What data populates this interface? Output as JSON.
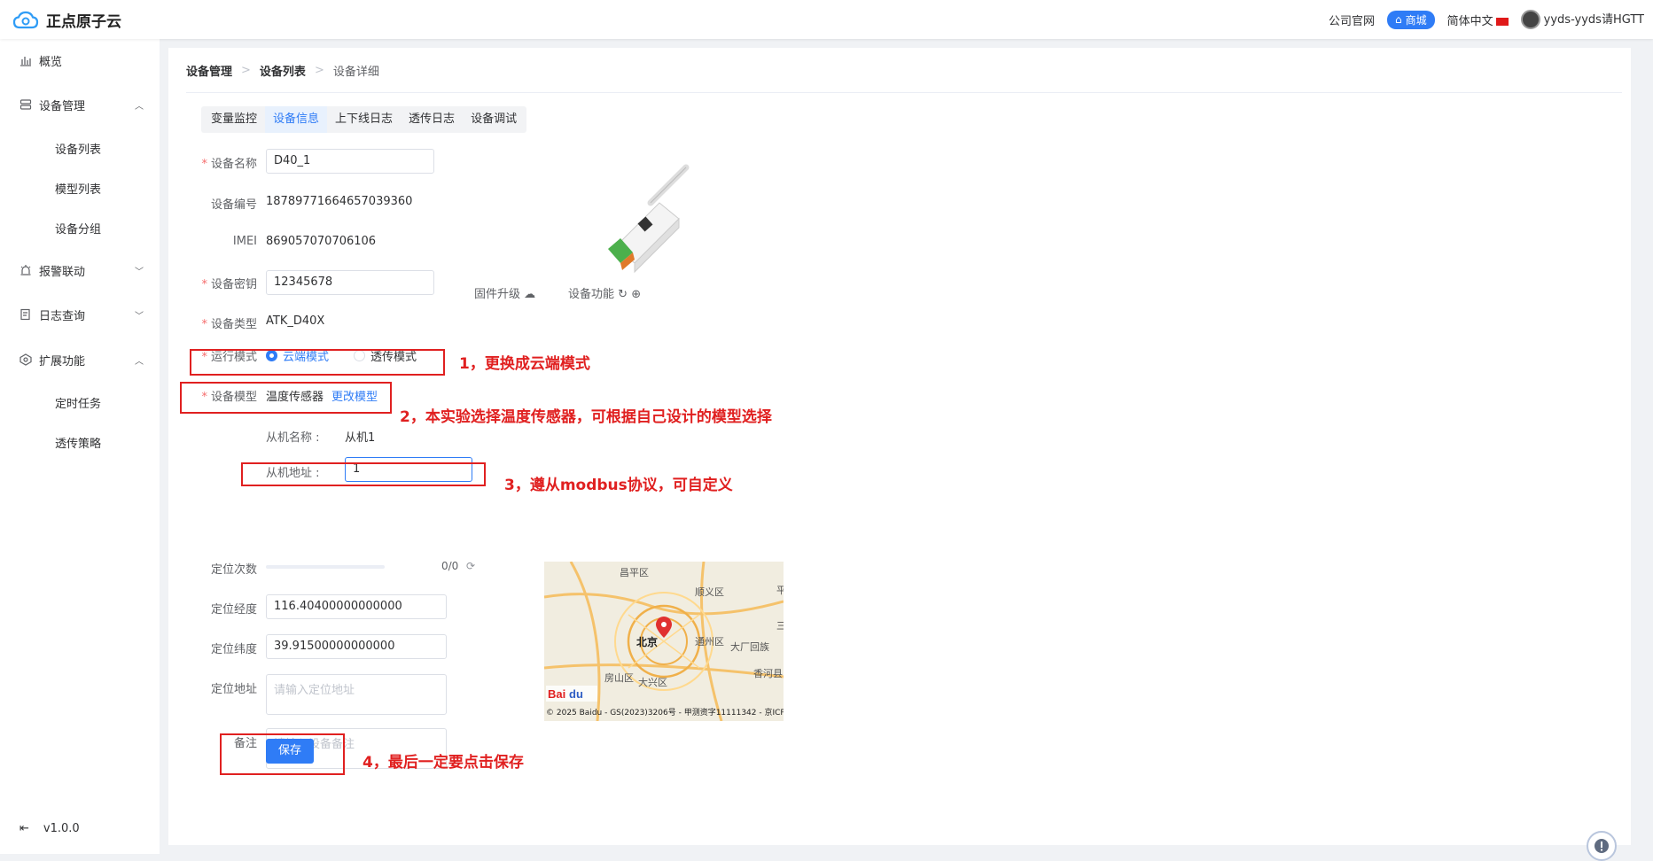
{
  "header": {
    "logo_text": "正点原子云",
    "links": [
      "公司官网",
      "商城",
      "简体中文"
    ],
    "user": "yyds-yyds请HGTT"
  },
  "sidebar": {
    "items": [
      {
        "label": "概览",
        "icon": "chart-icon"
      },
      {
        "label": "设备管理",
        "icon": "device-icon",
        "expanded": true
      },
      {
        "label": "报警联动",
        "icon": "alarm-icon",
        "expanded": false
      },
      {
        "label": "日志查询",
        "icon": "log-icon",
        "expanded": false
      },
      {
        "label": "扩展功能",
        "icon": "extension-icon",
        "expanded": true
      }
    ],
    "device_sub": [
      "设备列表",
      "模型列表",
      "设备分组"
    ],
    "extension_sub": [
      "定时任务",
      "透传策略"
    ],
    "version": "v1.0.0"
  },
  "breadcrumb": [
    "设备管理",
    "设备列表",
    "设备详细"
  ],
  "tabs": [
    {
      "label": "变量监控",
      "active": false
    },
    {
      "label": "设备信息",
      "active": true
    },
    {
      "label": "上下线日志",
      "active": false
    },
    {
      "label": "透传日志",
      "active": false
    },
    {
      "label": "设备调试",
      "active": false
    }
  ],
  "form": {
    "device_name_label": "设备名称",
    "device_name": "D40_1",
    "device_id_label": "设备编号",
    "device_id": "18789771664657039360",
    "imei_label": "IMEI",
    "imei": "869057070706106",
    "secret_label": "设备密钥",
    "secret": "12345678",
    "type_label": "设备类型",
    "type": "ATK_D40X",
    "mode_label": "运行模式",
    "mode_options": [
      "云端模式",
      "透传模式"
    ],
    "mode_selected": "云端模式",
    "model_label": "设备模型",
    "model": "温度传感器",
    "change_model": "更改模型",
    "slave_name_label": "从机名称 :",
    "slave_name": "从机1",
    "slave_addr_label": "从机地址 :",
    "slave_addr": "1",
    "locate_count_label": "定位次数",
    "locate_count": "0/0",
    "lng_label": "定位经度",
    "lng": "116.40400000000000",
    "lat_label": "定位纬度",
    "lat": "39.91500000000000",
    "addr_label": "定位地址",
    "addr_placeholder": "请输入定位地址",
    "note_label": "备注",
    "note_placeholder": "请输入设备备注",
    "save": "保存"
  },
  "device_actions": {
    "firmware": "固件升级",
    "function": "设备功能"
  },
  "map": {
    "labels": [
      "昌平区",
      "顺义区",
      "北京",
      "通州区",
      "大厂回族",
      "房山区",
      "大兴区",
      "香河县",
      "平",
      "三"
    ],
    "copyright": "© 2025 Baidu - GS(2023)3206号 - 甲测资字11111342 - 京ICP"
  },
  "annotations": [
    "1，更换成云端模式",
    "2，本实验选择温度传感器，可根据自己设计的模型选择",
    "3，遵从modbus协议，可自定义",
    "4，最后一定要点击保存"
  ],
  "colors": {
    "accent": "#2f7cf6",
    "annotation": "#e02020"
  }
}
